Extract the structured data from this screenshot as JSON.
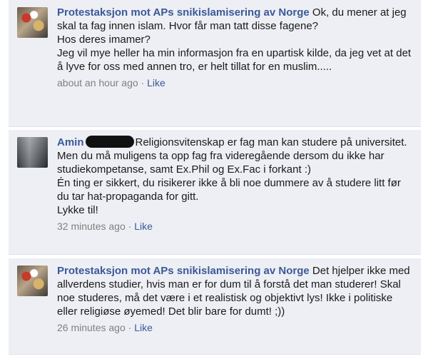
{
  "comments": [
    {
      "author": "Protestaksjon mot APs snikislamisering av Norge",
      "text": " Ok, du mener at jeg skal ta fag innen islam. Hvor får man tatt disse fagene?\nHos deres imamer?\nJeg vil mye heller ha min informasjon fra en upartisk kilde, da jeg vet at det å lyve for oss med annen tro, er helt tillat for en muslim.....",
      "time": "about an hour ago",
      "separator": " · ",
      "like_label": "Like"
    },
    {
      "author": "Amin",
      "text": "Religionsvitenskap er fag man kan studere på universitet.\nMen du må muligens ta opp fag fra videregående dersom du ikke har studiekompetanse, samt Ex.Phil og Ex.Fac i forkant :)\nÉn ting er sikkert, du risikerer ikke å bli noe dummere av å studere litt før du tar hat-propaganda for gitt.\nLykke til!",
      "time": "32 minutes ago",
      "separator": " · ",
      "like_label": "Like"
    },
    {
      "author": "Protestaksjon mot APs snikislamisering av Norge",
      "text": " Det hjelper ikke med allverdens studier, hvis man er for dum til å forstå det man studerer! Skal noe studeres, må det være i et realistisk og objektivt lys! Ikke i politiske eller religiøse øyemed! Det blir bare for dumt! ;))",
      "time": "26 minutes ago",
      "separator": " · ",
      "like_label": "Like"
    }
  ]
}
